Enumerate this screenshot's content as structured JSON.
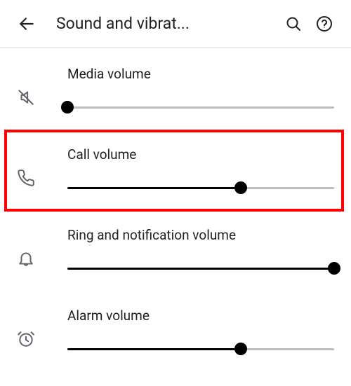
{
  "header": {
    "title": "Sound and vibrat..."
  },
  "rows": [
    {
      "key": "media",
      "label": "Media volume",
      "value": 0,
      "icon": "media-mute-icon"
    },
    {
      "key": "call",
      "label": "Call volume",
      "value": 65,
      "icon": "phone-icon"
    },
    {
      "key": "ring",
      "label": "Ring and notification volume",
      "value": 100,
      "icon": "bell-icon"
    },
    {
      "key": "alarm",
      "label": "Alarm volume",
      "value": 65,
      "icon": "clock-icon"
    }
  ],
  "highlight": {
    "target": "call"
  }
}
